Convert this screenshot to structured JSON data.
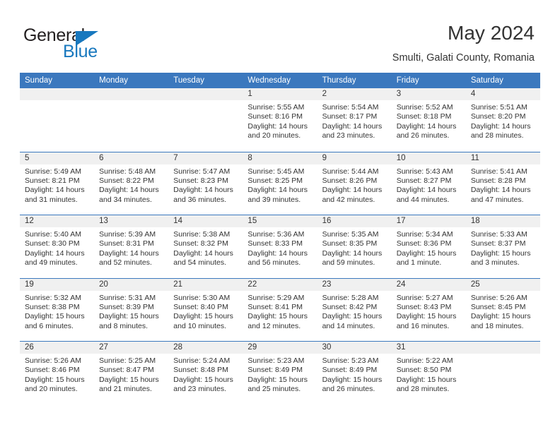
{
  "brand": {
    "name_part1": "General",
    "name_part2": "Blue",
    "logo_icon": "triangle-icon"
  },
  "header": {
    "month_title": "May 2024",
    "location": "Smulti, Galati County, Romania"
  },
  "colors": {
    "header_blue": "#3b78be",
    "brand_blue": "#1878be",
    "day_band": "#f0f0f0",
    "text": "#333333"
  },
  "weekdays": [
    "Sunday",
    "Monday",
    "Tuesday",
    "Wednesday",
    "Thursday",
    "Friday",
    "Saturday"
  ],
  "labels": {
    "sunrise_prefix": "Sunrise:",
    "sunset_prefix": "Sunset:",
    "daylight_prefix": "Daylight:"
  },
  "weeks": [
    [
      {
        "day": "",
        "empty": true,
        "sunrise": "",
        "sunset": "",
        "daylight": ""
      },
      {
        "day": "",
        "empty": true,
        "sunrise": "",
        "sunset": "",
        "daylight": ""
      },
      {
        "day": "",
        "empty": true,
        "sunrise": "",
        "sunset": "",
        "daylight": ""
      },
      {
        "day": "1",
        "sunrise": "Sunrise: 5:55 AM",
        "sunset": "Sunset: 8:16 PM",
        "daylight": "Daylight: 14 hours and 20 minutes."
      },
      {
        "day": "2",
        "sunrise": "Sunrise: 5:54 AM",
        "sunset": "Sunset: 8:17 PM",
        "daylight": "Daylight: 14 hours and 23 minutes."
      },
      {
        "day": "3",
        "sunrise": "Sunrise: 5:52 AM",
        "sunset": "Sunset: 8:18 PM",
        "daylight": "Daylight: 14 hours and 26 minutes."
      },
      {
        "day": "4",
        "sunrise": "Sunrise: 5:51 AM",
        "sunset": "Sunset: 8:20 PM",
        "daylight": "Daylight: 14 hours and 28 minutes."
      }
    ],
    [
      {
        "day": "5",
        "sunrise": "Sunrise: 5:49 AM",
        "sunset": "Sunset: 8:21 PM",
        "daylight": "Daylight: 14 hours and 31 minutes."
      },
      {
        "day": "6",
        "sunrise": "Sunrise: 5:48 AM",
        "sunset": "Sunset: 8:22 PM",
        "daylight": "Daylight: 14 hours and 34 minutes."
      },
      {
        "day": "7",
        "sunrise": "Sunrise: 5:47 AM",
        "sunset": "Sunset: 8:23 PM",
        "daylight": "Daylight: 14 hours and 36 minutes."
      },
      {
        "day": "8",
        "sunrise": "Sunrise: 5:45 AM",
        "sunset": "Sunset: 8:25 PM",
        "daylight": "Daylight: 14 hours and 39 minutes."
      },
      {
        "day": "9",
        "sunrise": "Sunrise: 5:44 AM",
        "sunset": "Sunset: 8:26 PM",
        "daylight": "Daylight: 14 hours and 42 minutes."
      },
      {
        "day": "10",
        "sunrise": "Sunrise: 5:43 AM",
        "sunset": "Sunset: 8:27 PM",
        "daylight": "Daylight: 14 hours and 44 minutes."
      },
      {
        "day": "11",
        "sunrise": "Sunrise: 5:41 AM",
        "sunset": "Sunset: 8:28 PM",
        "daylight": "Daylight: 14 hours and 47 minutes."
      }
    ],
    [
      {
        "day": "12",
        "sunrise": "Sunrise: 5:40 AM",
        "sunset": "Sunset: 8:30 PM",
        "daylight": "Daylight: 14 hours and 49 minutes."
      },
      {
        "day": "13",
        "sunrise": "Sunrise: 5:39 AM",
        "sunset": "Sunset: 8:31 PM",
        "daylight": "Daylight: 14 hours and 52 minutes."
      },
      {
        "day": "14",
        "sunrise": "Sunrise: 5:38 AM",
        "sunset": "Sunset: 8:32 PM",
        "daylight": "Daylight: 14 hours and 54 minutes."
      },
      {
        "day": "15",
        "sunrise": "Sunrise: 5:36 AM",
        "sunset": "Sunset: 8:33 PM",
        "daylight": "Daylight: 14 hours and 56 minutes."
      },
      {
        "day": "16",
        "sunrise": "Sunrise: 5:35 AM",
        "sunset": "Sunset: 8:35 PM",
        "daylight": "Daylight: 14 hours and 59 minutes."
      },
      {
        "day": "17",
        "sunrise": "Sunrise: 5:34 AM",
        "sunset": "Sunset: 8:36 PM",
        "daylight": "Daylight: 15 hours and 1 minute."
      },
      {
        "day": "18",
        "sunrise": "Sunrise: 5:33 AM",
        "sunset": "Sunset: 8:37 PM",
        "daylight": "Daylight: 15 hours and 3 minutes."
      }
    ],
    [
      {
        "day": "19",
        "sunrise": "Sunrise: 5:32 AM",
        "sunset": "Sunset: 8:38 PM",
        "daylight": "Daylight: 15 hours and 6 minutes."
      },
      {
        "day": "20",
        "sunrise": "Sunrise: 5:31 AM",
        "sunset": "Sunset: 8:39 PM",
        "daylight": "Daylight: 15 hours and 8 minutes."
      },
      {
        "day": "21",
        "sunrise": "Sunrise: 5:30 AM",
        "sunset": "Sunset: 8:40 PM",
        "daylight": "Daylight: 15 hours and 10 minutes."
      },
      {
        "day": "22",
        "sunrise": "Sunrise: 5:29 AM",
        "sunset": "Sunset: 8:41 PM",
        "daylight": "Daylight: 15 hours and 12 minutes."
      },
      {
        "day": "23",
        "sunrise": "Sunrise: 5:28 AM",
        "sunset": "Sunset: 8:42 PM",
        "daylight": "Daylight: 15 hours and 14 minutes."
      },
      {
        "day": "24",
        "sunrise": "Sunrise: 5:27 AM",
        "sunset": "Sunset: 8:43 PM",
        "daylight": "Daylight: 15 hours and 16 minutes."
      },
      {
        "day": "25",
        "sunrise": "Sunrise: 5:26 AM",
        "sunset": "Sunset: 8:45 PM",
        "daylight": "Daylight: 15 hours and 18 minutes."
      }
    ],
    [
      {
        "day": "26",
        "sunrise": "Sunrise: 5:26 AM",
        "sunset": "Sunset: 8:46 PM",
        "daylight": "Daylight: 15 hours and 20 minutes."
      },
      {
        "day": "27",
        "sunrise": "Sunrise: 5:25 AM",
        "sunset": "Sunset: 8:47 PM",
        "daylight": "Daylight: 15 hours and 21 minutes."
      },
      {
        "day": "28",
        "sunrise": "Sunrise: 5:24 AM",
        "sunset": "Sunset: 8:48 PM",
        "daylight": "Daylight: 15 hours and 23 minutes."
      },
      {
        "day": "29",
        "sunrise": "Sunrise: 5:23 AM",
        "sunset": "Sunset: 8:49 PM",
        "daylight": "Daylight: 15 hours and 25 minutes."
      },
      {
        "day": "30",
        "sunrise": "Sunrise: 5:23 AM",
        "sunset": "Sunset: 8:49 PM",
        "daylight": "Daylight: 15 hours and 26 minutes."
      },
      {
        "day": "31",
        "sunrise": "Sunrise: 5:22 AM",
        "sunset": "Sunset: 8:50 PM",
        "daylight": "Daylight: 15 hours and 28 minutes."
      },
      {
        "day": "",
        "empty": true,
        "sunrise": "",
        "sunset": "",
        "daylight": ""
      }
    ]
  ]
}
